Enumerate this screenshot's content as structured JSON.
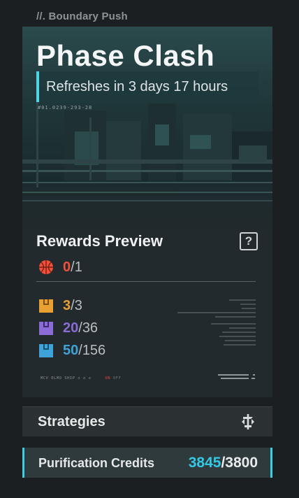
{
  "breadcrumb": "//. Boundary Push",
  "event": {
    "title": "Phase Clash",
    "refresh": "Refreshes in 3 days 17 hours",
    "serial": "#01.0239-293-28"
  },
  "rewards": {
    "title": "Rewards Preview",
    "help": "?",
    "items": [
      {
        "icon": "basketball-icon",
        "current": "0",
        "max": "1",
        "color": "#f0503c"
      },
      {
        "icon": "orange-box-icon",
        "current": "3",
        "max": "3",
        "color": "#e8a033"
      },
      {
        "icon": "purple-box-icon",
        "current": "20",
        "max": "36",
        "color": "#8b6cd6"
      },
      {
        "icon": "blue-box-icon",
        "current": "50",
        "max": "156",
        "color": "#3ea3d8"
      }
    ],
    "separator": "/"
  },
  "footer": {
    "ship": "MCV ELMO SHIP ◇ ◇ ◇",
    "on": "ON",
    "off": "OFF"
  },
  "strategies": {
    "label": "Strategies",
    "icon": "strategy-icon"
  },
  "credits": {
    "label": "Purification Credits",
    "current": "3845",
    "separator": "/",
    "max": "3800",
    "accent": "#33c8e6"
  }
}
